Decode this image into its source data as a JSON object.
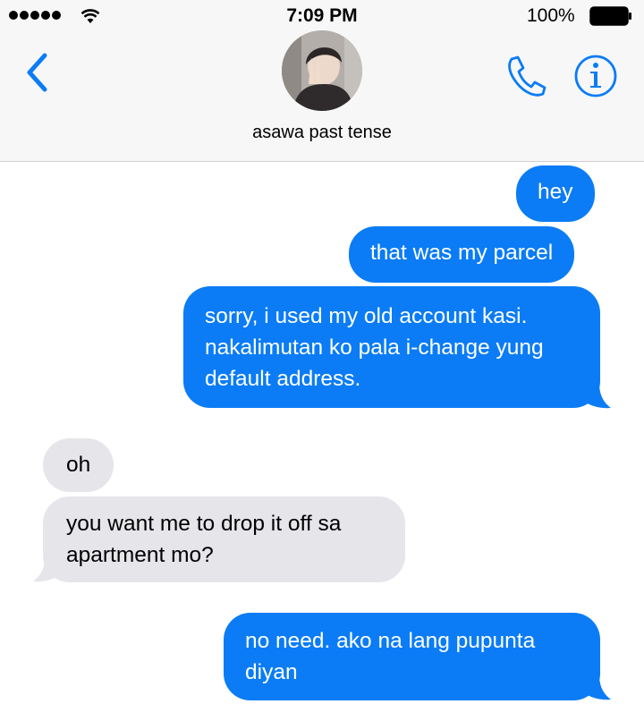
{
  "status_bar": {
    "time": "7:09 PM",
    "battery_percent": "100%",
    "signal_bars": 5
  },
  "header": {
    "contact_name": "asawa past tense",
    "icons": [
      "back-chevron-icon",
      "avatar",
      "phone-icon",
      "info-icon"
    ]
  },
  "colors": {
    "accent": "#0b7cf5",
    "sent_bubble": "#0b7cf5",
    "received_bubble": "#e5e5ea",
    "header_bg": "#f7f7f7"
  },
  "messages": [
    {
      "direction": "sent",
      "text": "hey"
    },
    {
      "direction": "sent",
      "text": "that was my parcel"
    },
    {
      "direction": "sent",
      "text": "sorry, i used my old account kasi. nakalimutan ko pala i-change yung default address."
    },
    {
      "direction": "received",
      "text": "oh"
    },
    {
      "direction": "received",
      "text": "you want me to drop it off sa apartment mo?"
    },
    {
      "direction": "sent",
      "text": "no need. ako na lang pupunta diyan"
    }
  ]
}
